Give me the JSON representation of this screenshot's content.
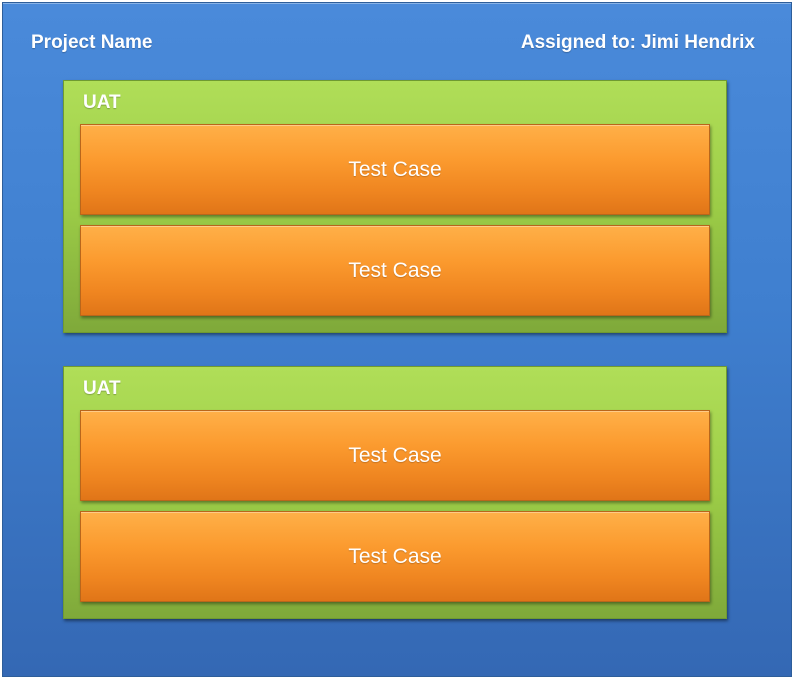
{
  "project": {
    "name": "Project Name",
    "assigned_prefix": "Assigned to:",
    "assignee": "Jimi Hendrix"
  },
  "groups": [
    {
      "title": "UAT",
      "test_cases": [
        "Test Case",
        "Test Case"
      ]
    },
    {
      "title": "UAT",
      "test_cases": [
        "Test Case",
        "Test Case"
      ]
    }
  ],
  "colors": {
    "project_fill": "#3f7fcf",
    "group_fill": "#9ccc47",
    "test_case_fill": "#f7901e",
    "text": "#ffffff"
  }
}
